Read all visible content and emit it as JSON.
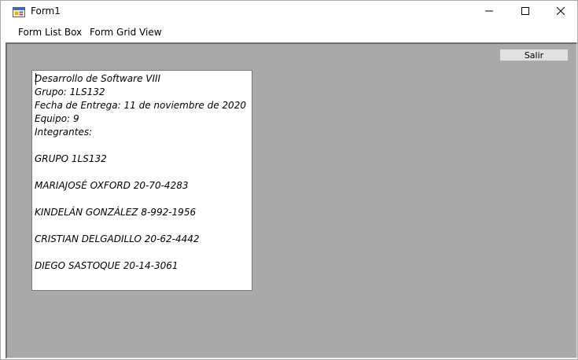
{
  "window": {
    "title": "Form1",
    "icon": "form-app-icon",
    "controls": {
      "minimize": "minimize-icon",
      "maximize": "maximize-icon",
      "close": "close-icon"
    }
  },
  "menu": {
    "items": [
      {
        "label": "Form List Box"
      },
      {
        "label": "Form Grid View"
      }
    ]
  },
  "buttons": {
    "exit_label": "Salir"
  },
  "textbox": {
    "lines": [
      "Desarrollo de Software VIII",
      "Grupo: 1LS132",
      "Fecha de Entrega: 11 de noviembre de 2020",
      "Equipo: 9",
      "Integrantes:",
      "",
      "GRUPO 1LS132",
      "",
      "MARIAJOSÉ OXFORD 20-70-4283",
      "",
      "KINDELÁN GONZÁLEZ 8-992-1956",
      "",
      "CRISTIAN DELGADILLO 20-62-4442",
      "",
      "DIEGO SASTOQUE 20-14-3061"
    ]
  },
  "colors": {
    "client_background": "#a9a9a9",
    "button_face": "#e1e1e1"
  }
}
